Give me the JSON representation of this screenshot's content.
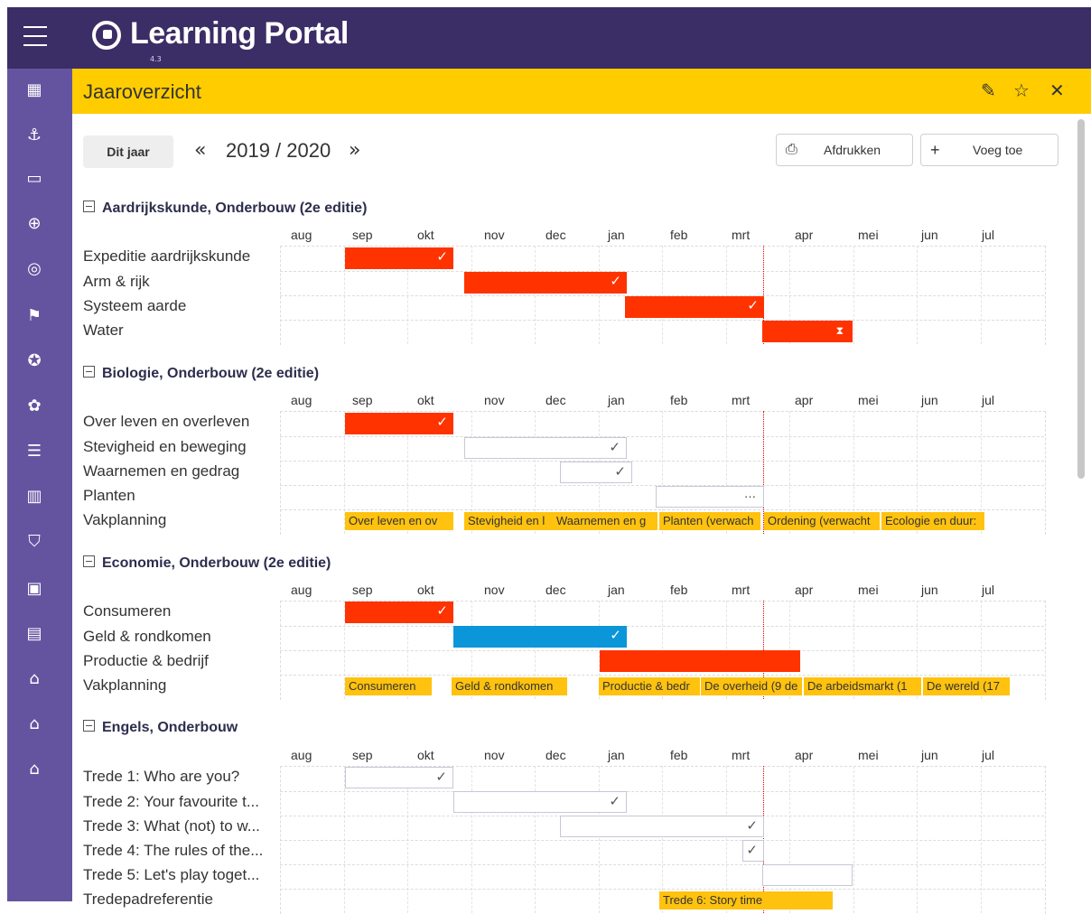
{
  "app": {
    "title": "Learning Portal",
    "version": "4.3"
  },
  "panel": {
    "title": "Jaaroverzicht"
  },
  "toolbar": {
    "this_year": "Dit jaar",
    "year": "2019 / 2020",
    "print": "Afdrukken",
    "add": "Voeg toe"
  },
  "months": [
    "aug",
    "sep",
    "okt",
    "nov",
    "dec",
    "jan",
    "feb",
    "mrt",
    "apr",
    "mei",
    "jun",
    "jul"
  ],
  "sections": [
    {
      "title": "Aardrijkskunde, Onderbouw (2e editie)",
      "rows": [
        "Expeditie aardrijkskunde",
        "Arm & rijk",
        "Systeem aarde",
        "Water"
      ]
    },
    {
      "title": "Biologie, Onderbouw (2e editie)",
      "rows": [
        "Over leven en overleven",
        "Stevigheid en beweging",
        "Waarnemen en gedrag",
        "Planten",
        "Vakplanning"
      ],
      "plans": [
        "Over leven en ov",
        "Stevigheid en l",
        "Waarnemen en g",
        "Planten (verwach",
        "Ordening (verwacht",
        "Ecologie en duur:"
      ]
    },
    {
      "title": "Economie, Onderbouw (2e editie)",
      "rows": [
        "Consumeren",
        "Geld & rondkomen",
        "Productie & bedrijf",
        "Vakplanning"
      ],
      "plans": [
        "Consumeren",
        "Geld & rondkomen",
        "Productie & bedr",
        "De overheid (9 de",
        "De arbeidsmarkt (1",
        "De wereld (17"
      ]
    },
    {
      "title": "Engels, Onderbouw",
      "rows": [
        "Trede 1: Who are you?",
        "Trede 2: Your favourite t...",
        "Trede 3: What (not) to w...",
        "Trede 4: The rules of the...",
        "Trede 5: Let's play toget...",
        "Tredepadreferentie"
      ],
      "plans": [
        "Trede 6: Story time"
      ]
    }
  ],
  "icons": {
    "hourglass": "hourglass-icon",
    "check": "check-icon"
  },
  "colors": {
    "header": "#3b2e66",
    "sidebar": "#6454a0",
    "accent": "#ffcc00",
    "done": "#ff3300",
    "active": "#0a96d9",
    "plan": "#ffc20e"
  }
}
